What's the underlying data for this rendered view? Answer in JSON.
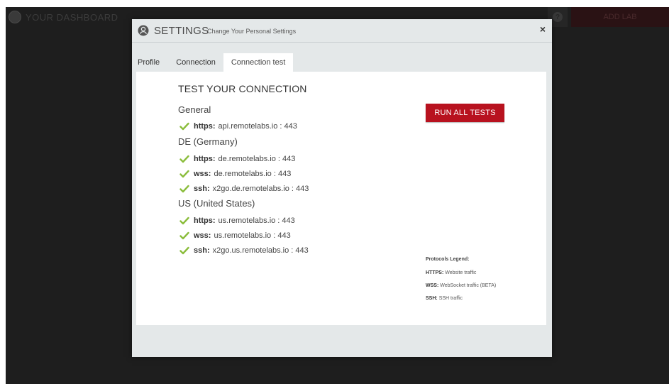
{
  "background": {
    "app_title": "YOUR DASHBOARD",
    "help_icon": "question-icon",
    "add_lab_label": "ADD LAB"
  },
  "modal": {
    "icon": "user-circle-icon",
    "title": "SETTINGS",
    "subtitle": "Change Your Personal Settings",
    "close_label": "×",
    "tabs": [
      {
        "label": "Profile",
        "active": false
      },
      {
        "label": "Connection",
        "active": false
      },
      {
        "label": "Connection test",
        "active": true
      }
    ]
  },
  "connection_test": {
    "title": "TEST YOUR CONNECTION",
    "run_all_label": "RUN ALL TESTS",
    "groups": [
      {
        "name": "General",
        "items": [
          {
            "protocol": "https:",
            "host": "api.remotelabs.io : 443",
            "status": "ok"
          }
        ]
      },
      {
        "name": "DE (Germany)",
        "items": [
          {
            "protocol": "https:",
            "host": "de.remotelabs.io : 443",
            "status": "ok"
          },
          {
            "protocol": "wss:",
            "host": "de.remotelabs.io : 443",
            "status": "ok"
          },
          {
            "protocol": "ssh:",
            "host": "x2go.de.remotelabs.io : 443",
            "status": "ok"
          }
        ]
      },
      {
        "name": "US (United States)",
        "items": [
          {
            "protocol": "https:",
            "host": "us.remotelabs.io : 443",
            "status": "ok"
          },
          {
            "protocol": "wss:",
            "host": "us.remotelabs.io : 443",
            "status": "ok"
          },
          {
            "protocol": "ssh:",
            "host": "x2go.us.remotelabs.io : 443",
            "status": "ok"
          }
        ]
      }
    ],
    "legend": {
      "title": "Protocols Legend:",
      "items": [
        {
          "key": "HTTPS:",
          "desc": "Website traffic"
        },
        {
          "key": "WSS:",
          "desc": "WebSocket traffic (BETA)"
        },
        {
          "key": "SSH:",
          "desc": "SSH traffic"
        }
      ]
    }
  },
  "colors": {
    "accent_red": "#b8121f",
    "check_green": "#8bbd3c",
    "overlay": "#1e1e1e"
  }
}
